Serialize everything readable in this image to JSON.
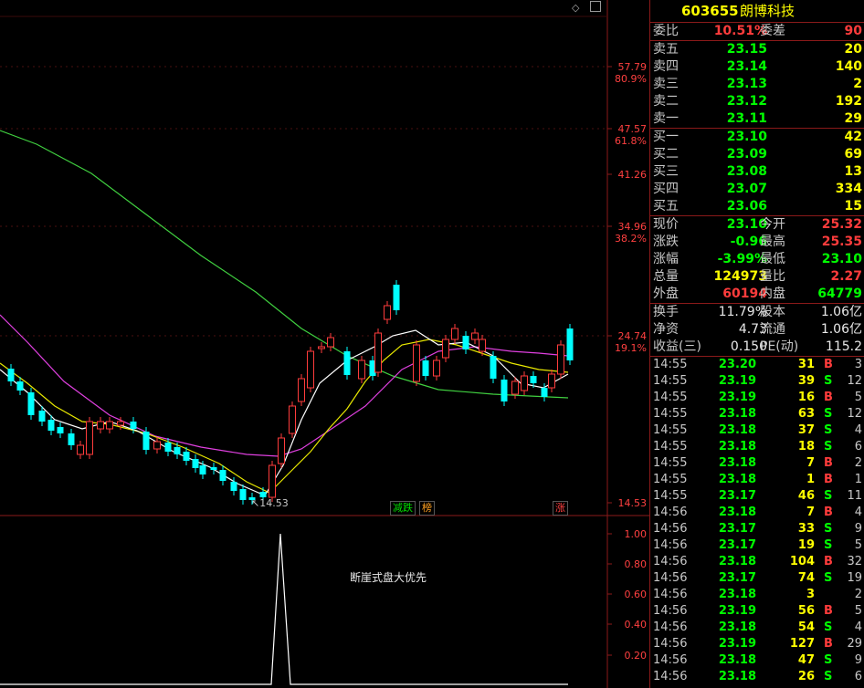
{
  "stock": {
    "code": "603655",
    "name": "朗博科技"
  },
  "ratio": {
    "label1": "委比",
    "value1": "10.51%",
    "label2": "委差",
    "value2": "90"
  },
  "asks": [
    {
      "label": "卖五",
      "price": "23.15",
      "vol": "20"
    },
    {
      "label": "卖四",
      "price": "23.14",
      "vol": "140"
    },
    {
      "label": "卖三",
      "price": "23.13",
      "vol": "2"
    },
    {
      "label": "卖二",
      "price": "23.12",
      "vol": "192"
    },
    {
      "label": "卖一",
      "price": "23.11",
      "vol": "29"
    }
  ],
  "bids": [
    {
      "label": "买一",
      "price": "23.10",
      "vol": "42"
    },
    {
      "label": "买二",
      "price": "23.09",
      "vol": "69"
    },
    {
      "label": "买三",
      "price": "23.08",
      "vol": "13"
    },
    {
      "label": "买四",
      "price": "23.07",
      "vol": "334"
    },
    {
      "label": "买五",
      "price": "23.06",
      "vol": "15"
    }
  ],
  "quote": [
    {
      "l1": "现价",
      "v1": "23.10",
      "c1": "green",
      "l2": "今开",
      "v2": "25.32",
      "c2": "red"
    },
    {
      "l1": "涨跌",
      "v1": "-0.96",
      "c1": "green",
      "l2": "最高",
      "v2": "25.35",
      "c2": "red"
    },
    {
      "l1": "涨幅",
      "v1": "-3.99%",
      "c1": "green",
      "l2": "最低",
      "v2": "23.10",
      "c2": "green"
    },
    {
      "l1": "总量",
      "v1": "124973",
      "c1": "yellow",
      "l2": "量比",
      "v2": "2.27",
      "c2": "red"
    },
    {
      "l1": "外盘",
      "v1": "60194",
      "c1": "red",
      "l2": "内盘",
      "v2": "64779",
      "c2": "green"
    }
  ],
  "fundamentals": [
    {
      "l1": "换手",
      "v1": "11.79%",
      "l2": "股本",
      "v2": "1.06亿"
    },
    {
      "l1": "净资",
      "v1": "4.73",
      "l2": "流通",
      "v2": "1.06亿"
    },
    {
      "l1": "收益(三)",
      "v1": "0.150",
      "l2": "PE(动)",
      "v2": "115.2"
    }
  ],
  "trades": [
    {
      "time": "14:55",
      "price": "23.20",
      "pc": "green",
      "vol": "31",
      "side": "B",
      "cnt": "3"
    },
    {
      "time": "14:55",
      "price": "23.19",
      "pc": "green",
      "vol": "39",
      "side": "S",
      "cnt": "12"
    },
    {
      "time": "14:55",
      "price": "23.19",
      "pc": "green",
      "vol": "16",
      "side": "B",
      "cnt": "5"
    },
    {
      "time": "14:55",
      "price": "23.18",
      "pc": "green",
      "vol": "63",
      "side": "S",
      "cnt": "12"
    },
    {
      "time": "14:55",
      "price": "23.18",
      "pc": "green",
      "vol": "37",
      "side": "S",
      "cnt": "4"
    },
    {
      "time": "14:55",
      "price": "23.18",
      "pc": "green",
      "vol": "18",
      "side": "S",
      "cnt": "6"
    },
    {
      "time": "14:55",
      "price": "23.18",
      "pc": "green",
      "vol": "7",
      "side": "B",
      "cnt": "2"
    },
    {
      "time": "14:55",
      "price": "23.18",
      "pc": "green",
      "vol": "1",
      "side": "B",
      "cnt": "1"
    },
    {
      "time": "14:55",
      "price": "23.17",
      "pc": "green",
      "vol": "46",
      "side": "S",
      "cnt": "11"
    },
    {
      "time": "14:56",
      "price": "23.18",
      "pc": "green",
      "vol": "7",
      "side": "B",
      "cnt": "4"
    },
    {
      "time": "14:56",
      "price": "23.17",
      "pc": "green",
      "vol": "33",
      "side": "S",
      "cnt": "9"
    },
    {
      "time": "14:56",
      "price": "23.17",
      "pc": "green",
      "vol": "19",
      "side": "S",
      "cnt": "5"
    },
    {
      "time": "14:56",
      "price": "23.18",
      "pc": "green",
      "vol": "104",
      "side": "B",
      "cnt": "32"
    },
    {
      "time": "14:56",
      "price": "23.17",
      "pc": "green",
      "vol": "74",
      "side": "S",
      "cnt": "19"
    },
    {
      "time": "14:56",
      "price": "23.18",
      "pc": "green",
      "vol": "3",
      "side": "",
      "cnt": "2"
    },
    {
      "time": "14:56",
      "price": "23.19",
      "pc": "green",
      "vol": "56",
      "side": "B",
      "cnt": "5"
    },
    {
      "time": "14:56",
      "price": "23.18",
      "pc": "green",
      "vol": "54",
      "side": "S",
      "cnt": "4"
    },
    {
      "time": "14:56",
      "price": "23.19",
      "pc": "green",
      "vol": "127",
      "side": "B",
      "cnt": "29"
    },
    {
      "time": "14:56",
      "price": "23.18",
      "pc": "green",
      "vol": "47",
      "side": "S",
      "cnt": "9"
    },
    {
      "time": "14:56",
      "price": "23.18",
      "pc": "green",
      "vol": "26",
      "side": "S",
      "cnt": "6"
    }
  ],
  "price_axis": [
    {
      "price": "57.79",
      "pct": "80.9%"
    },
    {
      "price": "47.57",
      "pct": "61.8%"
    },
    {
      "price": "41.26",
      "pct": ""
    },
    {
      "price": "34.96",
      "pct": "38.2%"
    },
    {
      "price": "24.74",
      "pct": "19.1%"
    },
    {
      "price": "14.53",
      "pct": ""
    }
  ],
  "indicator_axis": [
    "1.00",
    "0.80",
    "0.60",
    "0.40",
    "0.20"
  ],
  "labels": {
    "low_marker": "14.53",
    "tag_reduce": "减跌",
    "tag_list": "榜",
    "tag_up": "涨",
    "indicator_title": "断崖式盘大优先"
  },
  "colors": {
    "up": "#ff3c3c",
    "down": "#00ffff",
    "ma_white": "#ffffff",
    "ma_yellow": "#e8e800",
    "ma_magenta": "#e040e0",
    "ma_green": "#40d040"
  },
  "chart_data": {
    "type": "candlestick",
    "price_ticks": [
      57.79,
      47.57,
      41.26,
      34.96,
      24.74,
      14.53
    ],
    "pct_ticks": [
      "80.9%",
      "61.8%",
      "38.2%",
      "19.1%"
    ],
    "indicator": {
      "ylim": [
        0,
        1
      ],
      "ticks": [
        1.0,
        0.8,
        0.6,
        0.4,
        0.2
      ],
      "peak_value": 1.0,
      "title": "断崖式盘大优先"
    },
    "low": 14.53
  }
}
